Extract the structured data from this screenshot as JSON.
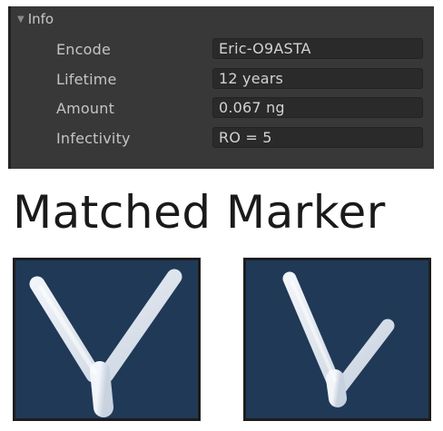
{
  "inspector": {
    "foldout_label": "Info",
    "fields": [
      {
        "label": "Encode",
        "value": "Eric-O9ASTA"
      },
      {
        "label": "Lifetime",
        "value": "12 years"
      },
      {
        "label": "Amount",
        "value": "0.067 ng"
      },
      {
        "label": "Infectivity",
        "value": "RO = 5"
      }
    ]
  },
  "heading": "Matched Marker",
  "markers": [
    {
      "icon": "v-marker-icon"
    },
    {
      "icon": "check-marker-icon"
    }
  ],
  "colors": {
    "panel_bg": "#383838",
    "field_bg": "#2a2a2a",
    "marker_bg": "#203957",
    "marker_shape": "#e6ebf2"
  }
}
